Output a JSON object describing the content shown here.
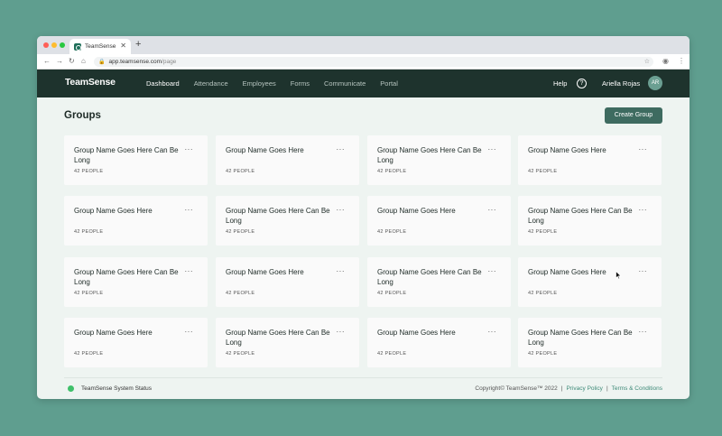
{
  "browser": {
    "tab_title": "TeamSense",
    "url_host": "app.teamsense.com",
    "url_path": "/page"
  },
  "nav": {
    "logo": "TeamSense",
    "links": [
      "Dashboard",
      "Attendance",
      "Employees",
      "Forms",
      "Communicate",
      "Portal"
    ],
    "help": "Help",
    "user_name": "Ariella Rojas",
    "avatar_initials": "AR"
  },
  "page": {
    "title": "Groups",
    "create_button": "Create Group"
  },
  "groups": [
    {
      "name": "Group Name Goes Here Can Be Long",
      "count": "42 PEOPLE"
    },
    {
      "name": "Group Name Goes Here",
      "count": "42 PEOPLE"
    },
    {
      "name": "Group Name Goes Here Can Be Long",
      "count": "42 PEOPLE"
    },
    {
      "name": "Group Name Goes Here",
      "count": "42 PEOPLE"
    },
    {
      "name": "Group Name Goes Here",
      "count": "42 PEOPLE"
    },
    {
      "name": "Group Name Goes Here Can Be Long",
      "count": "42 PEOPLE"
    },
    {
      "name": "Group Name Goes Here",
      "count": "42 PEOPLE"
    },
    {
      "name": "Group Name Goes Here Can Be Long",
      "count": "42 PEOPLE"
    },
    {
      "name": "Group Name Goes Here Can Be Long",
      "count": "42 PEOPLE"
    },
    {
      "name": "Group Name Goes Here",
      "count": "42 PEOPLE"
    },
    {
      "name": "Group Name Goes Here Can Be Long",
      "count": "42 PEOPLE"
    },
    {
      "name": "Group Name Goes Here",
      "count": "42 PEOPLE"
    },
    {
      "name": "Group Name Goes Here",
      "count": "42 PEOPLE"
    },
    {
      "name": "Group Name Goes Here Can Be Long",
      "count": "42 PEOPLE"
    },
    {
      "name": "Group Name Goes Here",
      "count": "42 PEOPLE"
    },
    {
      "name": "Group Name Goes Here Can Be Long",
      "count": "42 PEOPLE"
    }
  ],
  "footer": {
    "status_text": "TeamSense System Status",
    "copyright": "Copyright© TeamSense™ 2022",
    "privacy": "Privacy Policy",
    "terms": "Terms & Conditions"
  },
  "colors": {
    "nav_bg": "#1e332d",
    "accent": "#3e6b60",
    "status_ok": "#3fc06a",
    "link": "#3e8a78"
  }
}
